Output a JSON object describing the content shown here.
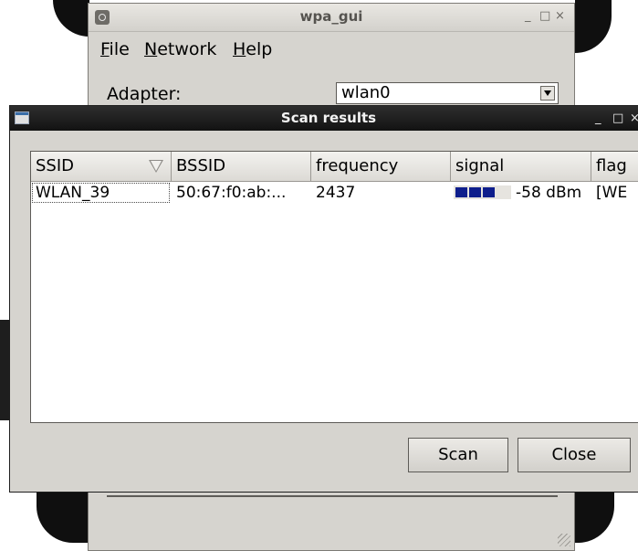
{
  "main_window": {
    "title": "wpa_gui",
    "menu": [
      {
        "mnemonic": "F",
        "rest": "ile"
      },
      {
        "mnemonic": "N",
        "rest": "etwork"
      },
      {
        "mnemonic": "H",
        "rest": "elp"
      }
    ],
    "adapter_label": "Adapter:",
    "adapter_value": "wlan0",
    "controls": [
      "_",
      "□",
      "×"
    ]
  },
  "scan_window": {
    "title": "Scan results",
    "controls": [
      "_",
      "□",
      "×"
    ],
    "table": {
      "columns": [
        "SSID",
        "BSSID",
        "frequency",
        "signal",
        "flag"
      ],
      "sorted_column": "SSID",
      "rows": [
        {
          "ssid": "WLAN_39",
          "bssid": "50:67:f0:ab:...",
          "frequency": "2437",
          "signal_text": "-58 dBm",
          "signal_bars": 3,
          "flags": "[WE"
        }
      ]
    },
    "buttons": {
      "scan": "Scan",
      "close": "Close"
    }
  },
  "colors": {
    "window_bg": "#d6d4cf",
    "scan_titlebar": "#1a1a1a",
    "signal_bar": "#0e1e8c"
  }
}
